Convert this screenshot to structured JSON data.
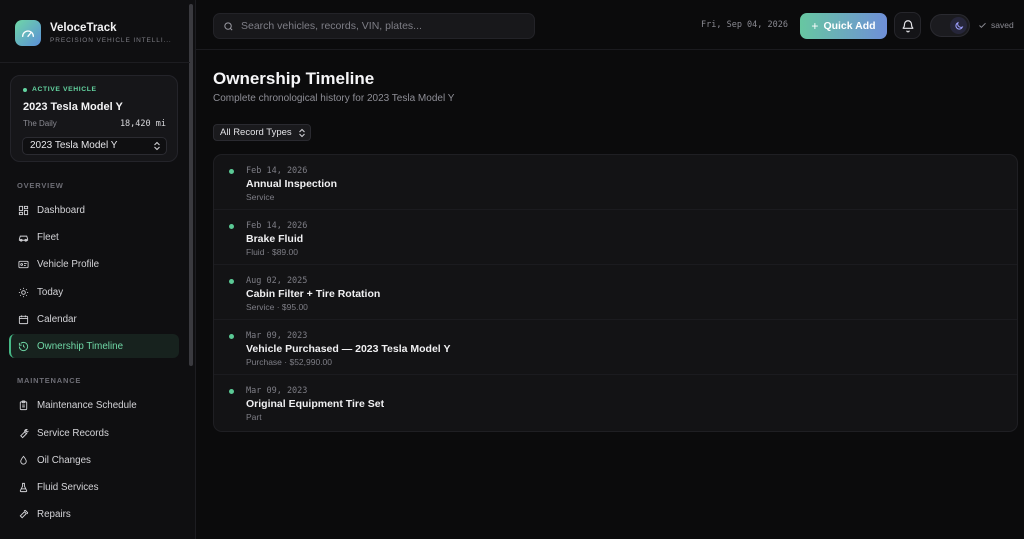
{
  "brand": {
    "name": "VeloceTrack",
    "tagline": "PRECISION VEHICLE INTELLI..."
  },
  "active_vehicle": {
    "label": "ACTIVE VEHICLE",
    "name": "2023 Tesla Model Y",
    "nickname": "The Daily",
    "mileage": "18,420 mi",
    "selected": "2023 Tesla Model Y"
  },
  "sidebar": {
    "overview_label": "OVERVIEW",
    "overview_items": [
      {
        "label": "Dashboard"
      },
      {
        "label": "Fleet"
      },
      {
        "label": "Vehicle Profile"
      },
      {
        "label": "Today"
      },
      {
        "label": "Calendar"
      },
      {
        "label": "Ownership Timeline",
        "active": true
      }
    ],
    "maintenance_label": "MAINTENANCE",
    "maintenance_items": [
      {
        "label": "Maintenance Schedule"
      },
      {
        "label": "Service Records"
      },
      {
        "label": "Oil Changes"
      },
      {
        "label": "Fluid Services"
      },
      {
        "label": "Repairs"
      }
    ]
  },
  "topbar": {
    "search_placeholder": "Search vehicles, records, VIN, plates...",
    "date": "Fri, Sep 04, 2026",
    "quick_add_label": "Quick Add",
    "saved_label": "saved"
  },
  "page": {
    "title": "Ownership Timeline",
    "subtitle": "Complete chronological history for 2023 Tesla Model Y",
    "filter_label": "All Record Types"
  },
  "timeline": [
    {
      "date": "Feb 14, 2026",
      "title": "Annual Inspection",
      "meta": "Service"
    },
    {
      "date": "Feb 14, 2026",
      "title": "Brake Fluid",
      "meta": "Fluid · $89.00"
    },
    {
      "date": "Aug 02, 2025",
      "title": "Cabin Filter + Tire Rotation",
      "meta": "Service · $95.00"
    },
    {
      "date": "Mar 09, 2023",
      "title": "Vehicle Purchased — 2023 Tesla Model Y",
      "meta": "Purchase · $52,990.00"
    },
    {
      "date": "Mar 09, 2023",
      "title": "Original Equipment Tire Set",
      "meta": "Part"
    }
  ],
  "colors": {
    "accent": "#63d3a0",
    "accent_blue": "#6f8fd8",
    "background": "#0b0b0c"
  }
}
